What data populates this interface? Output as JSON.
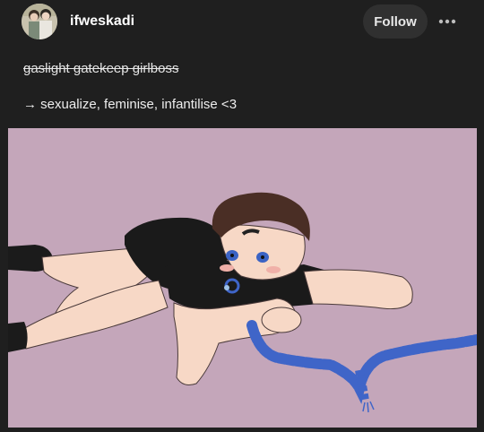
{
  "post": {
    "username": "ifweskadi",
    "follow_label": "Follow",
    "more_icon": "ellipsis-icon",
    "strikethrough_text": "gaslight gatekeep girlboss",
    "body_text": "→ sexualize, feminise, infantilise <3"
  },
  "colors": {
    "background": "#1f1f1f",
    "follow_button": "#303030",
    "art_background": "#c4a6ba",
    "rope": "#3f65c8",
    "shirt": "#1a1a1a",
    "skin": "#f7d8c6",
    "hair": "#4a2e25"
  }
}
